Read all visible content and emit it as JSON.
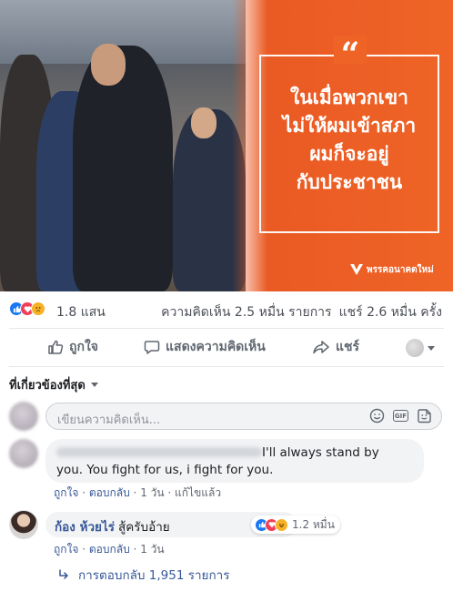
{
  "post": {
    "quote_mark": "“",
    "quote_lines": [
      "ในเมื่อพวกเขา",
      "ไม่ให้ผมเข้าสภา",
      "ผมก็จะอยู่",
      "กับประชาชน"
    ],
    "brand_name": "พรรคอนาคตใหม่",
    "colors": {
      "accent": "#ef6426",
      "link": "#385898"
    }
  },
  "stats": {
    "reactions_count": "1.8 แสน",
    "reaction_icons": [
      "like-icon",
      "love-icon",
      "sad-icon"
    ],
    "comments_label": "ความคิดเห็น 2.5 หมื่น รายการ",
    "shares_label": "แชร์ 2.6 หมื่น ครั้ง"
  },
  "actions": {
    "like": "ถูกใจ",
    "comment": "แสดงความคิดเห็น",
    "share": "แชร์"
  },
  "comments_section": {
    "filter_label": "ที่เกี่ยวข้องที่สุด",
    "compose_placeholder": "เขียนความคิดเห็น...",
    "gif_label": "GIF",
    "comments": [
      {
        "text_line1": "I'll always stand by",
        "text_line2": "you. You fight for us, i fight for you.",
        "meta": {
          "like": "ถูกใจ",
          "reply": "ตอบกลับ",
          "time": "1 วัน",
          "edited": "แก้ไขแล้ว",
          "sep": " · "
        }
      },
      {
        "author": "ก้อง ห้วยไร่",
        "text": "สู้ครับอ้าย",
        "reaction_count": "1.2 หมื่น",
        "meta": {
          "like": "ถูกใจ",
          "reply": "ตอบกลับ",
          "time": "1 วัน",
          "sep": " · "
        }
      }
    ],
    "replies_label": "การตอบกลับ 1,951 รายการ"
  }
}
